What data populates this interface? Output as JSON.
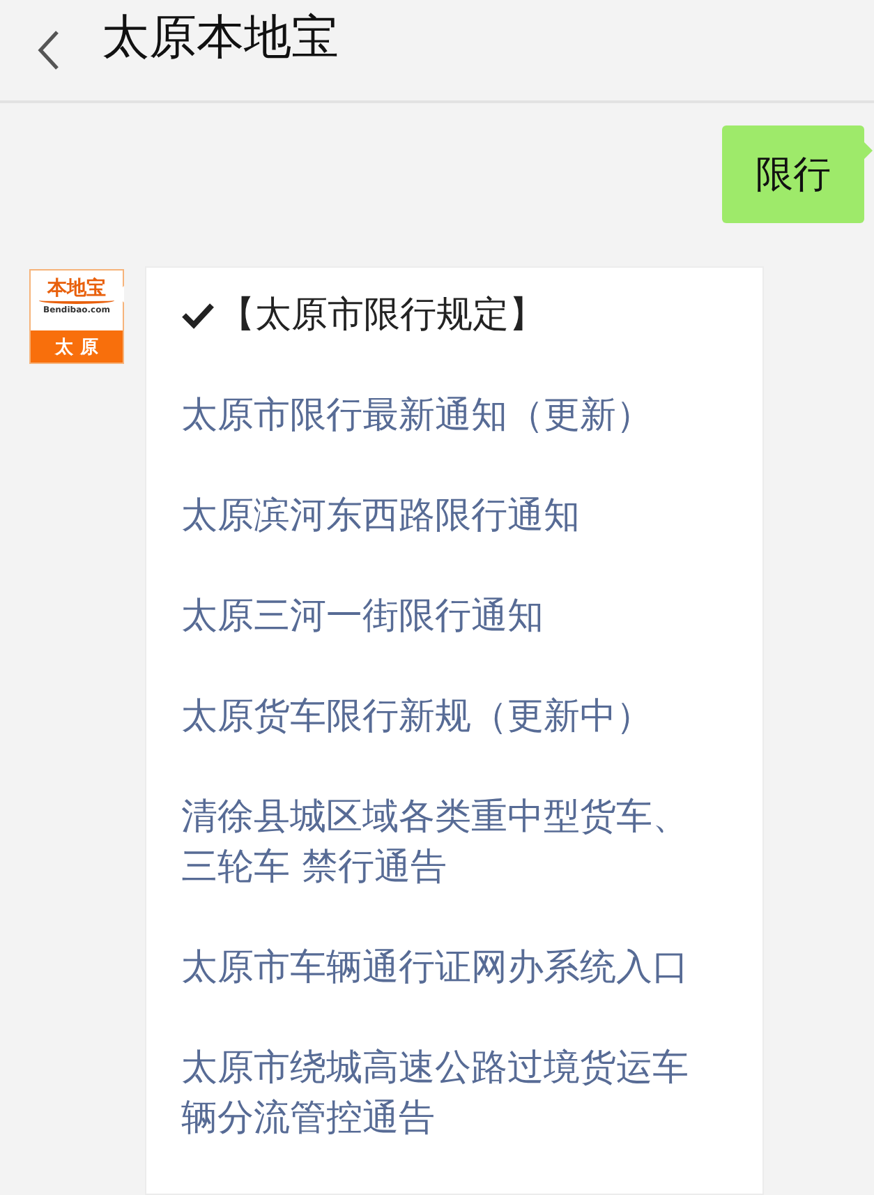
{
  "header": {
    "title": "太原本地宝"
  },
  "messages": [
    {
      "kind": "sent",
      "text": "限行"
    },
    {
      "kind": "reply",
      "avatar": {
        "brand": "本地宝",
        "site": "Bendibao.com",
        "city": "太 原"
      },
      "items": [
        {
          "kind": "heading",
          "text": "【太原市限行规定】"
        },
        {
          "kind": "link",
          "text": "太原市限行最新通知（更新）"
        },
        {
          "kind": "link",
          "text": "太原滨河东西路限行通知"
        },
        {
          "kind": "link",
          "text": "太原三河一街限行通知"
        },
        {
          "kind": "link",
          "text": "太原货车限行新规（更新中）"
        },
        {
          "kind": "link",
          "text": "清徐县城区域各类重中型货车、三轮车 禁行通告"
        },
        {
          "kind": "link",
          "text": "太原市车辆通行证网办系统入口"
        },
        {
          "kind": "link",
          "text": "太原市绕城高速公路过境货运车辆分流管控通告"
        }
      ]
    }
  ]
}
